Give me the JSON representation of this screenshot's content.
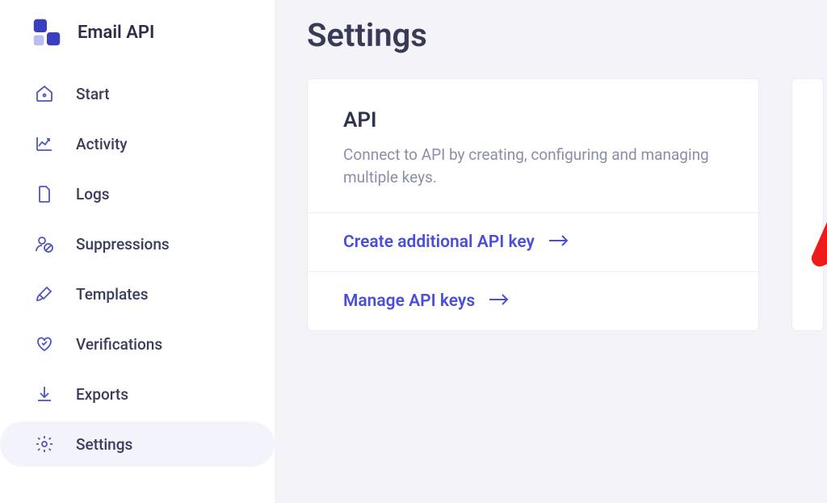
{
  "sidebar": {
    "title": "Email API",
    "items": [
      {
        "label": "Start"
      },
      {
        "label": "Activity"
      },
      {
        "label": "Logs"
      },
      {
        "label": "Suppressions"
      },
      {
        "label": "Templates"
      },
      {
        "label": "Verifications"
      },
      {
        "label": "Exports"
      },
      {
        "label": "Settings"
      }
    ]
  },
  "page": {
    "title": "Settings"
  },
  "card_api": {
    "title": "API",
    "description": "Connect to API by creating, configuring and managing multiple keys.",
    "actions": [
      {
        "label": "Create additional API key"
      },
      {
        "label": "Manage API keys"
      }
    ]
  }
}
